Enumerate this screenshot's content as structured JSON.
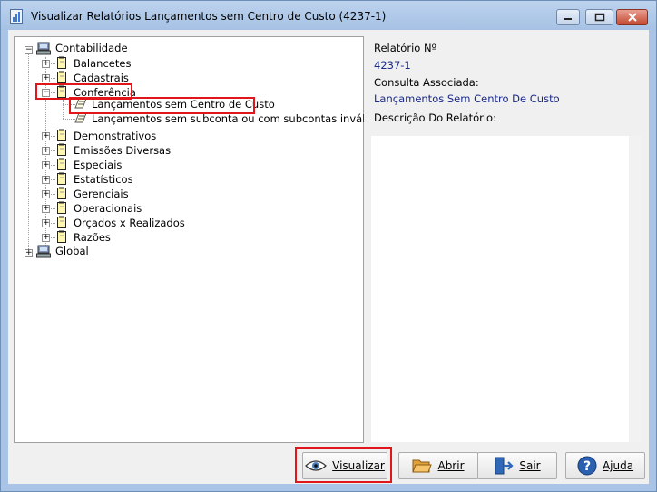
{
  "window": {
    "title": "Visualizar Relatórios Lançamentos sem Centro de Custo (4237-1)"
  },
  "tree": {
    "root1": "Contabilidade",
    "children": [
      "Balancetes",
      "Cadastrais",
      "Conferência",
      "Demonstrativos",
      "Emissões Diversas",
      "Especiais",
      "Estatísticos",
      "Gerenciais",
      "Operacionais",
      "Orçados x Realizados",
      "Razões"
    ],
    "conferencia_items": [
      "Lançamentos sem Centro de Custo",
      "Lançamentos sem subconta ou com subcontas inválidas"
    ],
    "root2": "Global"
  },
  "details": {
    "relatorio_label": "Relatório Nº",
    "relatorio_value": "4237-1",
    "consulta_label": "Consulta Associada:",
    "consulta_value": "Lançamentos Sem Centro De Custo",
    "descricao_label": "Descrição Do Relatório:"
  },
  "buttons": {
    "visualizar": "Visualizar",
    "abrir": "Abrir",
    "sair": "Sair",
    "ajuda": "Ajuda"
  },
  "colors": {
    "highlight": "#e0161b",
    "value_text": "#1b2a8a"
  }
}
